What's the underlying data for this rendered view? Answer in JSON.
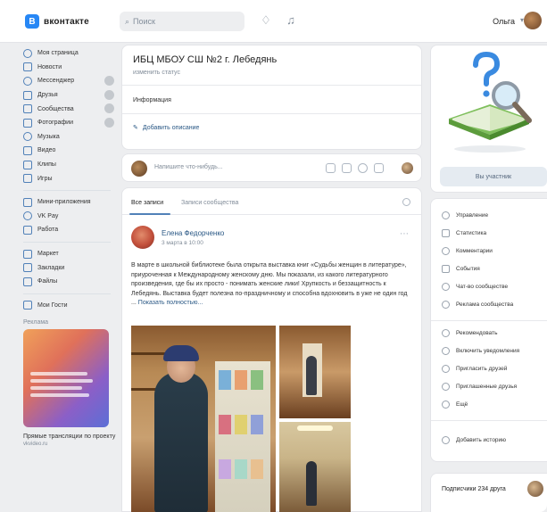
{
  "header": {
    "logo_letter": "В",
    "logo_text": "вконтакте",
    "search_placeholder": "Поиск",
    "user_name": "Ольга"
  },
  "sidebar": {
    "items": [
      {
        "label": "Моя страница"
      },
      {
        "label": "Новости"
      },
      {
        "label": "Мессенджер"
      },
      {
        "label": "Друзья"
      },
      {
        "label": "Сообщества"
      },
      {
        "label": "Фотографии"
      },
      {
        "label": "Музыка"
      },
      {
        "label": "Видео"
      },
      {
        "label": "Клипы"
      },
      {
        "label": "Игры"
      }
    ],
    "items2": [
      {
        "label": "Мини-приложения"
      },
      {
        "label": "VK Pay"
      },
      {
        "label": "Работа"
      }
    ],
    "items3": [
      {
        "label": "Маркет"
      },
      {
        "label": "Закладки"
      },
      {
        "label": "Файлы"
      }
    ],
    "items4": [
      {
        "label": "Мои Гости"
      }
    ],
    "promo_section_title": "Реклама",
    "promo_caption": "Прямые трансляции по проекту",
    "promo_sub": "vkvideo.ru"
  },
  "group": {
    "title": "ИБЦ МБОУ СШ №2 г. Лебедянь",
    "status": "изменить статус",
    "info_label": "Информация",
    "add_description": "Добавить описание"
  },
  "compose": {
    "placeholder": "Напишите что-нибудь..."
  },
  "feed": {
    "tabs": [
      "Все записи",
      "Записи сообщества"
    ],
    "post": {
      "author": "Елена Федорченко",
      "date": "3 марта в 10:00",
      "text": "В марте в школьной библиотеке была открыта выставка книг «Судьбы женщин в литературе», приуроченная к Международному женскому дню. Мы показали, из какого литературного произведения, где бы их просто - понимать женские лики! Хрупкость и беззащитность к Лебедянь. Выставка будет полезна по-праздничному и способна вдохновить в уже не один год ...",
      "more": "Показать полностью..."
    }
  },
  "right": {
    "join_button": "Вы участник",
    "menu": [
      {
        "label": "Управление"
      },
      {
        "label": "Статистика"
      },
      {
        "label": "Комментарии"
      },
      {
        "label": "События"
      },
      {
        "label": "Чат-во сообществе"
      },
      {
        "label": "Реклама сообщества"
      },
      {
        "label": "Рекомендовать"
      },
      {
        "label": "Включить уведомления"
      },
      {
        "label": "Пригласить друзей"
      },
      {
        "label": "Приглашенные друзья"
      },
      {
        "label": "Ещё"
      }
    ],
    "add_story": "Добавить историю",
    "bottom_label": "Подписчики 234 друга"
  },
  "colors": {
    "accent": "#5181b8",
    "link": "#2a5885",
    "background": "#edeef0"
  }
}
